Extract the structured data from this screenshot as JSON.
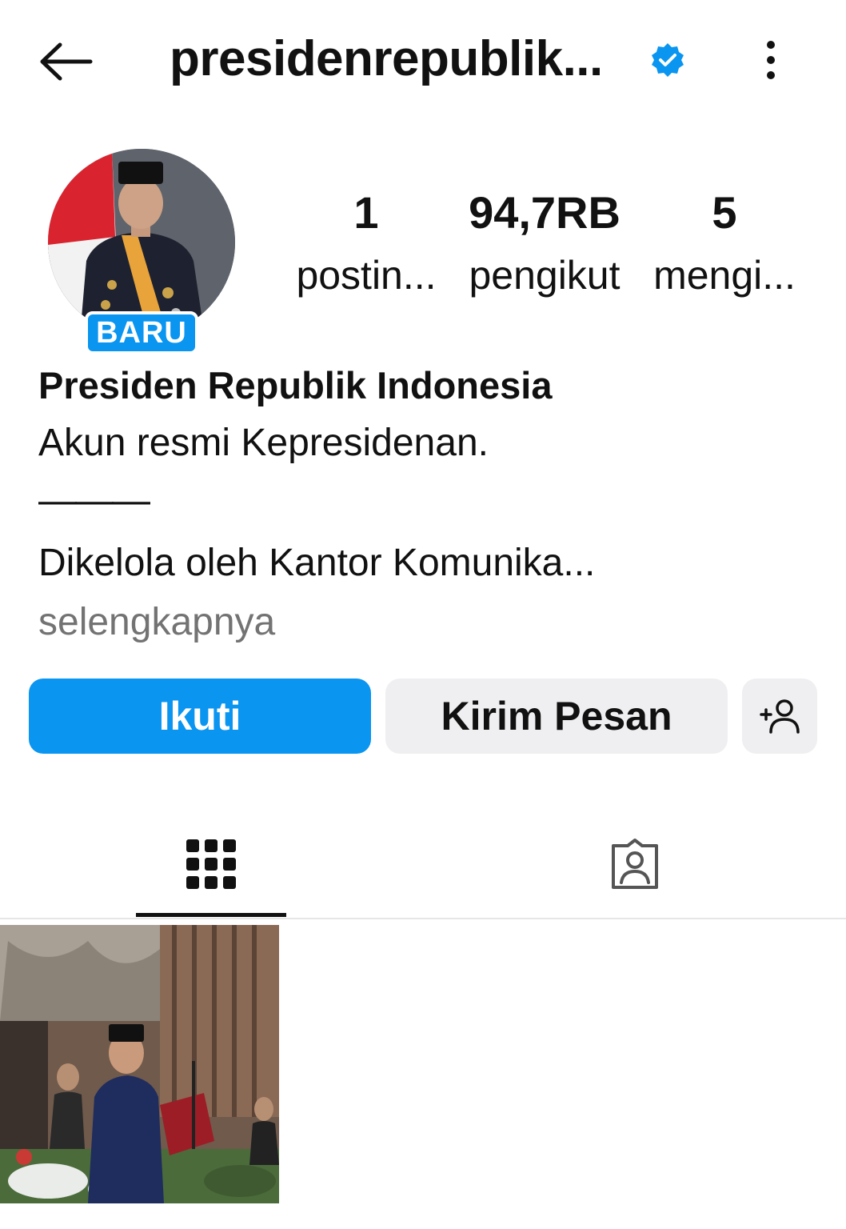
{
  "header": {
    "username": "presidenrepublik...",
    "back_icon": "arrow-left-icon",
    "verified_icon": "verified-badge-icon",
    "more_icon": "more-vertical-icon"
  },
  "profile": {
    "avatar_badge": "BARU",
    "stats": {
      "posts": {
        "value": "1",
        "label": "postin..."
      },
      "followers": {
        "value": "94,7RB",
        "label": "pengikut"
      },
      "following": {
        "value": "5",
        "label": "mengi..."
      }
    },
    "display_name": "Presiden Republik Indonesia",
    "bio_lines": [
      "Akun resmi Kepresidenan.",
      "———",
      "Dikelola oleh Kantor Komunika..."
    ],
    "more_link": "selengkapnya"
  },
  "actions": {
    "follow_label": "Ikuti",
    "message_label": "Kirim Pesan",
    "suggest_icon": "add-person-icon"
  },
  "tabs": [
    {
      "icon": "grid-icon",
      "active": true
    },
    {
      "icon": "tagged-person-icon",
      "active": false
    }
  ],
  "colors": {
    "accent": "#0a95f0",
    "secondary_button": "#efeff1",
    "muted_text": "#737373",
    "verified": "#0a95f0"
  }
}
